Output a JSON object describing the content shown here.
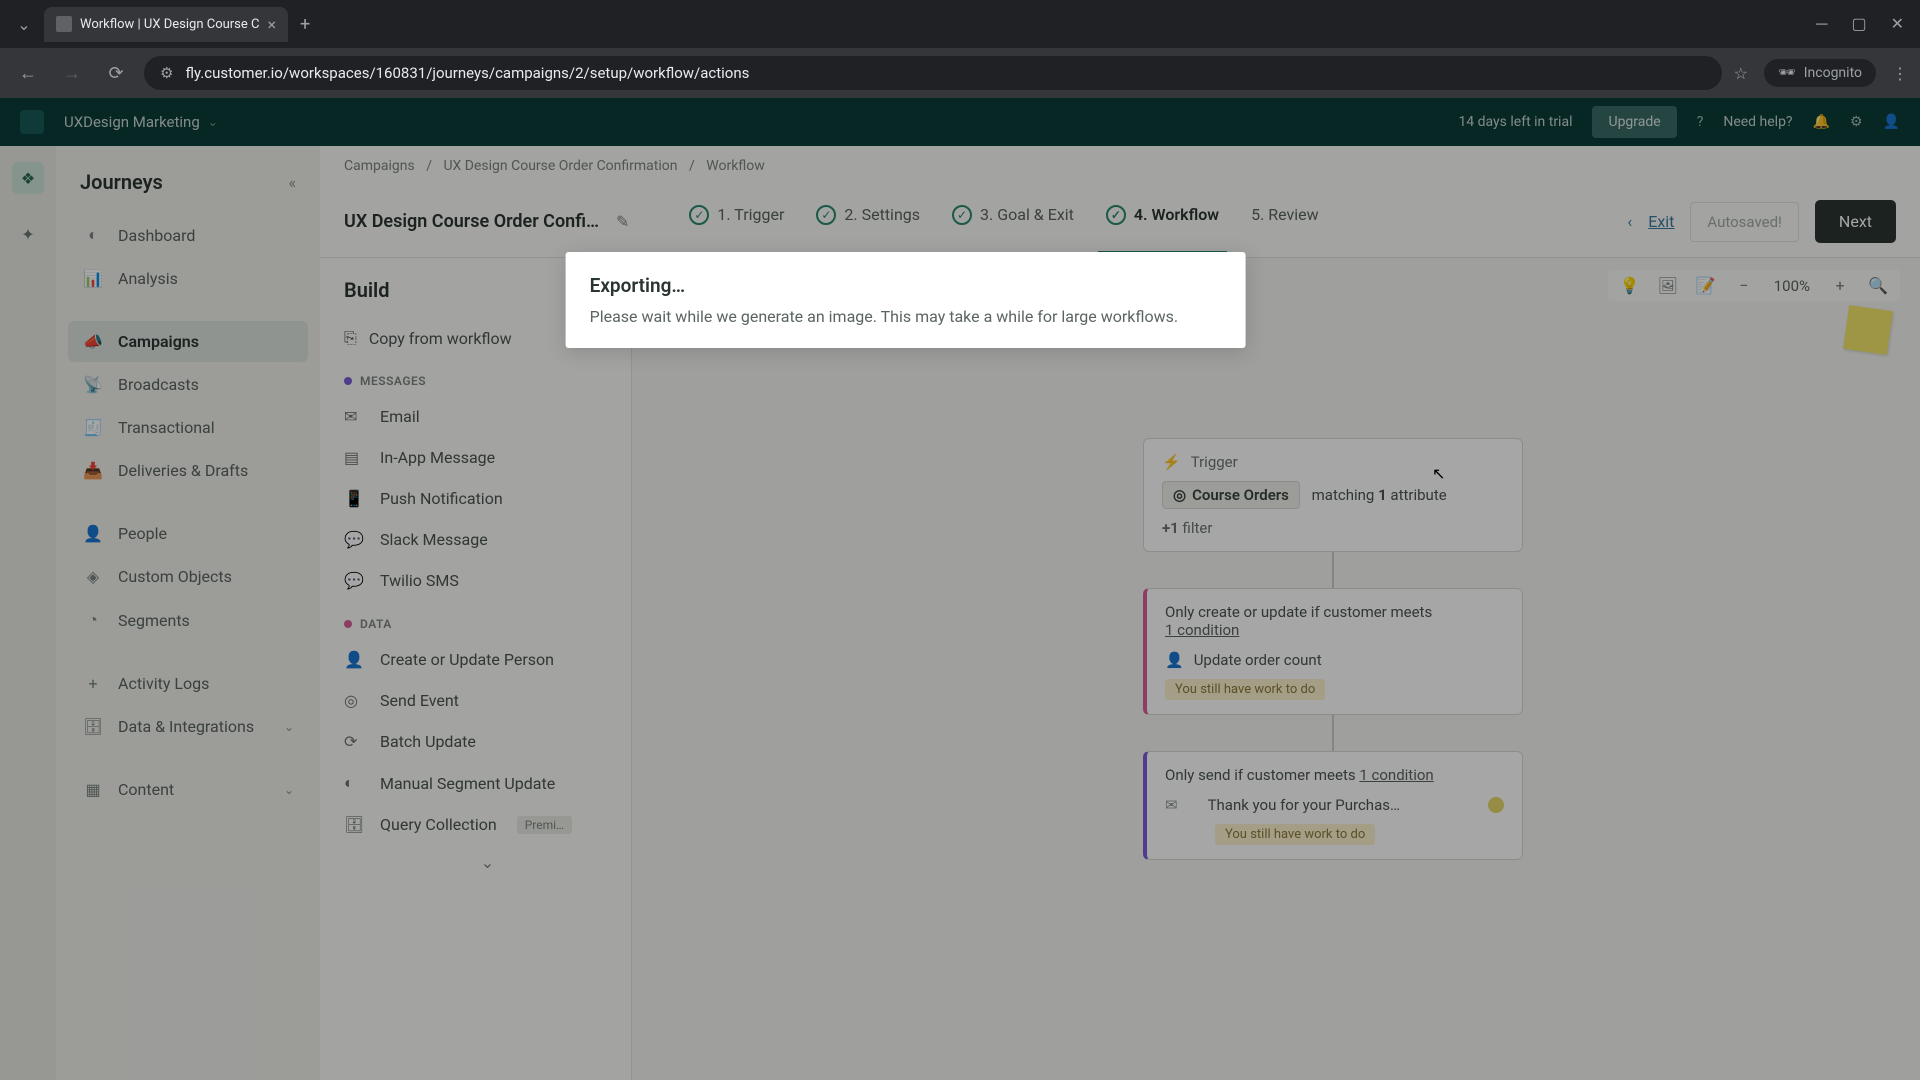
{
  "browser": {
    "tab_title": "Workflow | UX Design Course C",
    "url": "fly.customer.io/workspaces/160831/journeys/campaigns/2/setup/workflow/actions",
    "incognito": "Incognito"
  },
  "header": {
    "workspace": "UXDesign Marketing",
    "trial": "14 days left in trial",
    "upgrade": "Upgrade",
    "help": "Need help?"
  },
  "sidebar": {
    "title": "Journeys",
    "items": [
      {
        "label": "Dashboard"
      },
      {
        "label": "Analysis"
      },
      {
        "label": "Campaigns"
      },
      {
        "label": "Broadcasts"
      },
      {
        "label": "Transactional"
      },
      {
        "label": "Deliveries & Drafts"
      },
      {
        "label": "People"
      },
      {
        "label": "Custom Objects"
      },
      {
        "label": "Segments"
      },
      {
        "label": "Activity Logs"
      },
      {
        "label": "Data & Integrations"
      },
      {
        "label": "Content"
      }
    ]
  },
  "breadcrumb": {
    "a": "Campaigns",
    "b": "UX Design Course Order Confirmation",
    "c": "Workflow"
  },
  "workflow": {
    "title": "UX Design Course Order Confir…",
    "steps": {
      "s1": "1. Trigger",
      "s2": "2. Settings",
      "s3": "3. Goal & Exit",
      "s4": "4. Workflow",
      "s5": "5. Review"
    },
    "exit": "Exit",
    "autosaved": "Autosaved!",
    "next": "Next"
  },
  "build": {
    "title": "Build",
    "copy": "Copy from workflow",
    "messages_label": "MESSAGES",
    "data_label": "DATA",
    "messages": {
      "email": "Email",
      "inapp": "In-App Message",
      "push": "Push Notification",
      "slack": "Slack Message",
      "twilio": "Twilio SMS"
    },
    "data": {
      "person": "Create or Update Person",
      "event": "Send Event",
      "batch": "Batch Update",
      "segment": "Manual Segment Update",
      "query": "Query Collection",
      "premium": "Premi…"
    }
  },
  "canvas": {
    "zoom": "100%",
    "trigger": {
      "label": "Trigger",
      "segment": "Course Orders",
      "matching": "matching",
      "count": "1",
      "attribute": "attribute",
      "plus": "+1",
      "filter": "filter"
    },
    "node2": {
      "text": "Only create or update if customer meets",
      "cond": "1 condition",
      "action": "Update order count",
      "badge": "You still have work to do"
    },
    "node3": {
      "text": "Only send if customer meets",
      "cond": "1 condition",
      "subject": "Thank you for your Purchas…",
      "badge": "You still have work to do"
    }
  },
  "modal": {
    "title": "Exporting…",
    "body": "Please wait while we generate an image. This may take a while for large workflows."
  }
}
